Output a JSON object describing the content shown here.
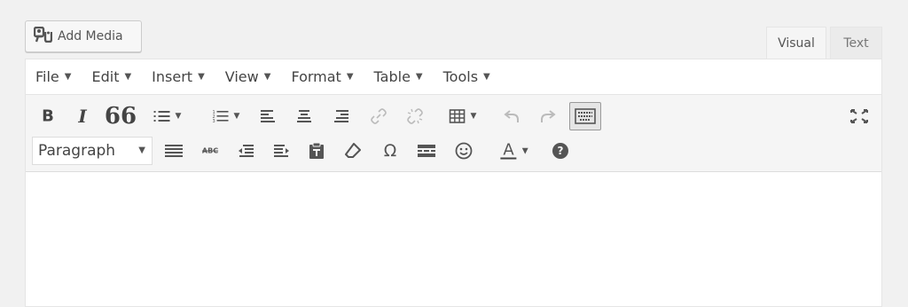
{
  "add_media": {
    "label": "Add Media",
    "icon": "media-icon"
  },
  "tabs": [
    {
      "label": "Visual",
      "active": true
    },
    {
      "label": "Text",
      "active": false
    }
  ],
  "menubar": [
    {
      "label": "File"
    },
    {
      "label": "Edit"
    },
    {
      "label": "Insert"
    },
    {
      "label": "View"
    },
    {
      "label": "Format"
    },
    {
      "label": "Table"
    },
    {
      "label": "Tools"
    }
  ],
  "toolbar": {
    "row1": [
      "bold",
      "italic",
      "blockquote",
      "bullet-list",
      "numbered-list",
      "align-left",
      "align-center",
      "align-right",
      "link",
      "unlink",
      "table",
      "undo",
      "redo",
      "toolbar-toggle",
      "fullscreen"
    ],
    "row2": [
      "format-select",
      "justify",
      "strikethrough",
      "outdent",
      "indent",
      "paste-as-text",
      "clear-formatting",
      "special-character",
      "read-more",
      "emoticons",
      "text-color",
      "help"
    ],
    "format_select": {
      "value": "Paragraph"
    },
    "bold_glyph": "B",
    "italic_glyph": "I",
    "quote_glyph": "66",
    "omega_glyph": "Ω",
    "strike_glyph": "ABC",
    "text_color_glyph": "A",
    "help_glyph": "?"
  },
  "colors": {
    "background": "#f1f1f1",
    "toolbar": "#f5f5f5",
    "icon": "#555555",
    "text_color_underline": "#444444"
  }
}
